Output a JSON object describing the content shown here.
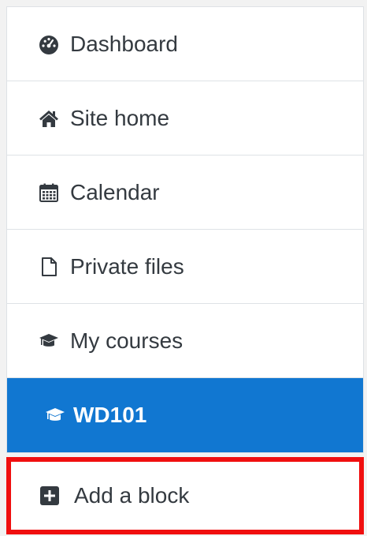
{
  "nav": {
    "items": [
      {
        "label": "Dashboard",
        "icon": "dashboard-icon",
        "active": false
      },
      {
        "label": "Site home",
        "icon": "home-icon",
        "active": false
      },
      {
        "label": "Calendar",
        "icon": "calendar-icon",
        "active": false
      },
      {
        "label": "Private files",
        "icon": "file-icon",
        "active": false
      },
      {
        "label": "My courses",
        "icon": "graduation-cap-icon",
        "active": false
      },
      {
        "label": "WD101",
        "icon": "graduation-cap-icon",
        "active": true
      }
    ],
    "add_block": {
      "label": "Add a block",
      "icon": "plus-square-icon"
    }
  },
  "colors": {
    "active_bg": "#1177d1",
    "highlight_border": "#f00f0f",
    "text": "#343a40"
  }
}
